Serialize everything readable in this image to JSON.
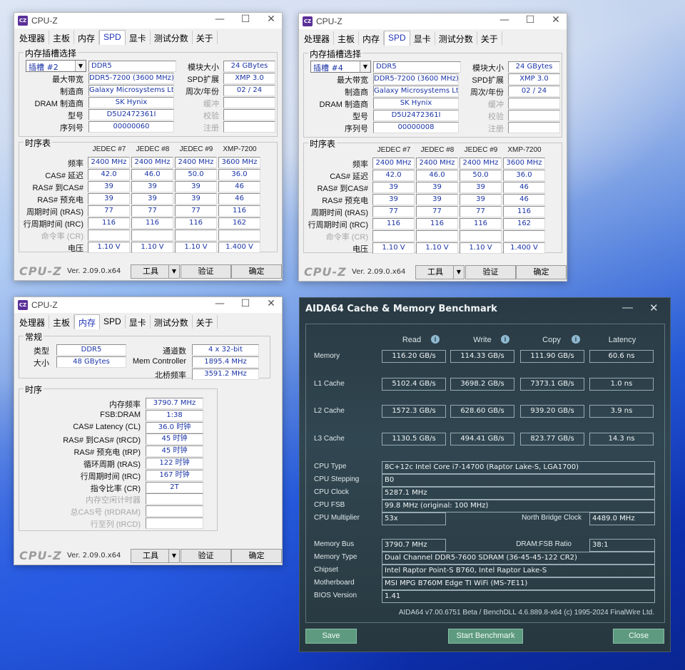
{
  "cpuz_common": {
    "title": "CPU-Z",
    "tabs": [
      "处理器",
      "主板",
      "内存",
      "SPD",
      "显卡",
      "测试分数",
      "关于"
    ],
    "logo": "CPU-Z",
    "version": "Ver. 2.09.0.x64",
    "tools_button": "工具",
    "validate_button": "验证",
    "ok_button": "确定",
    "dropdown_arrow": "▼"
  },
  "spd_labels": {
    "group_slot": "内存插槽选择",
    "module_size": "模块大小",
    "max_bandwidth": "最大带宽",
    "spd_ext": "SPD扩展",
    "manufacturer": "制造商",
    "week_year": "周次/年份",
    "dram_mfr": "DRAM 制造商",
    "buffered": "缓冲",
    "part_number": "型号",
    "correction": "校验",
    "serial": "序列号",
    "registered": "注册",
    "group_timings": "时序表",
    "columns": [
      "JEDEC #7",
      "JEDEC #8",
      "JEDEC #9",
      "XMP-7200"
    ],
    "rows": [
      "频率",
      "CAS# 延迟",
      "RAS# 到CAS#",
      "RAS# 预充电",
      "周期时间 (tRAS)",
      "行周期时间 (tRC)",
      "命令率 (CR)",
      "电压"
    ]
  },
  "spd_slot2": {
    "slot": "插槽 #2",
    "type": "DDR5",
    "module_size": "24 GBytes",
    "max_bandwidth": "DDR5-7200 (3600 MHz)",
    "spd_ext": "XMP 3.0",
    "manufacturer": "Galaxy Microsystems Ltd.",
    "week_year": "02 / 24",
    "dram_mfr": "SK Hynix",
    "part_number": "D5U2472361I",
    "serial": "00000060",
    "timings": [
      [
        "2400 MHz",
        "2400 MHz",
        "2400 MHz",
        "3600 MHz"
      ],
      [
        "42.0",
        "46.0",
        "50.0",
        "36.0"
      ],
      [
        "39",
        "39",
        "39",
        "46"
      ],
      [
        "39",
        "39",
        "39",
        "46"
      ],
      [
        "77",
        "77",
        "77",
        "116"
      ],
      [
        "116",
        "116",
        "116",
        "162"
      ],
      [
        "",
        "",
        "",
        ""
      ],
      [
        "1.10 V",
        "1.10 V",
        "1.10 V",
        "1.400 V"
      ]
    ]
  },
  "spd_slot4": {
    "slot": "插槽 #4",
    "type": "DDR5",
    "module_size": "24 GBytes",
    "max_bandwidth": "DDR5-7200 (3600 MHz)",
    "spd_ext": "XMP 3.0",
    "manufacturer": "Galaxy Microsystems Ltd.",
    "week_year": "02 / 24",
    "dram_mfr": "SK Hynix",
    "part_number": "D5U2472361I",
    "serial": "00000008",
    "timings": [
      [
        "2400 MHz",
        "2400 MHz",
        "2400 MHz",
        "3600 MHz"
      ],
      [
        "42.0",
        "46.0",
        "50.0",
        "36.0"
      ],
      [
        "39",
        "39",
        "39",
        "46"
      ],
      [
        "39",
        "39",
        "39",
        "46"
      ],
      [
        "77",
        "77",
        "77",
        "116"
      ],
      [
        "116",
        "116",
        "116",
        "162"
      ],
      [
        "",
        "",
        "",
        ""
      ],
      [
        "1.10 V",
        "1.10 V",
        "1.10 V",
        "1.400 V"
      ]
    ]
  },
  "memory_tab": {
    "group_general": "常规",
    "type_label": "类型",
    "type": "DDR5",
    "size_label": "大小",
    "size": "48 GBytes",
    "channels_label": "通道数",
    "channels": "4 x 32-bit",
    "mem_controller_label": "Mem Controller",
    "mem_controller": "1895.4 MHz",
    "nb_freq_label": "北桥频率",
    "nb_freq": "3591.2 MHz",
    "group_timings": "时序",
    "rows": [
      {
        "label": "内存频率",
        "value": "3790.7 MHz",
        "disabled": false
      },
      {
        "label": "FSB:DRAM",
        "value": "1:38",
        "disabled": false
      },
      {
        "label": "CAS# Latency (CL)",
        "value": "36.0 时钟",
        "disabled": false
      },
      {
        "label": "RAS# 到CAS# (tRCD)",
        "value": "45 时钟",
        "disabled": false
      },
      {
        "label": "RAS# 预充电 (tRP)",
        "value": "45 时钟",
        "disabled": false
      },
      {
        "label": "循环周期 (tRAS)",
        "value": "122 时钟",
        "disabled": false
      },
      {
        "label": "行周期时间 (tRC)",
        "value": "167 时钟",
        "disabled": false
      },
      {
        "label": "指令比率 (CR)",
        "value": "2T",
        "disabled": false
      },
      {
        "label": "内存空闲计时器",
        "value": "",
        "disabled": true
      },
      {
        "label": "总CAS号 (tRDRAM)",
        "value": "",
        "disabled": true
      },
      {
        "label": "行至列 (tRCD)",
        "value": "",
        "disabled": true
      }
    ]
  },
  "aida": {
    "title": "AIDA64 Cache & Memory Benchmark",
    "minimize": "—",
    "close": "✕",
    "info_glyph": "i",
    "headers": [
      "Read",
      "Write",
      "Copy",
      "Latency"
    ],
    "bench_rows": [
      {
        "label": "Memory",
        "values": [
          "116.20 GB/s",
          "114.33 GB/s",
          "111.90 GB/s",
          "60.6 ns"
        ]
      },
      {
        "label": "L1 Cache",
        "values": [
          "5102.4 GB/s",
          "3698.2 GB/s",
          "7373.1 GB/s",
          "1.0 ns"
        ]
      },
      {
        "label": "L2 Cache",
        "values": [
          "1572.3 GB/s",
          "628.60 GB/s",
          "939.20 GB/s",
          "3.9 ns"
        ]
      },
      {
        "label": "L3 Cache",
        "values": [
          "1130.5 GB/s",
          "494.41 GB/s",
          "823.77 GB/s",
          "14.3 ns"
        ]
      }
    ],
    "cpu_type_label": "CPU Type",
    "cpu_type": "8C+12c Intel Core i7-14700  (Raptor Lake-S, LGA1700)",
    "cpu_stepping_label": "CPU Stepping",
    "cpu_stepping": "B0",
    "cpu_clock_label": "CPU Clock",
    "cpu_clock": "5287.1 MHz",
    "cpu_fsb_label": "CPU FSB",
    "cpu_fsb": "99.8 MHz  (original: 100 MHz)",
    "cpu_multiplier_label": "CPU Multiplier",
    "cpu_multiplier": "53x",
    "nb_clock_label": "North Bridge Clock",
    "nb_clock": "4489.0 MHz",
    "memory_bus_label": "Memory Bus",
    "memory_bus": "3790.7 MHz",
    "dram_fsb_label": "DRAM:FSB Ratio",
    "dram_fsb": "38:1",
    "memory_type_label": "Memory Type",
    "memory_type": "Dual Channel DDR5-7600 SDRAM  (36-45-45-122 CR2)",
    "chipset_label": "Chipset",
    "chipset": "Intel Raptor Point-S B760, Intel Raptor Lake-S",
    "motherboard_label": "Motherboard",
    "motherboard": "MSI MPG B760M Edge TI WiFi (MS-7E11)",
    "bios_label": "BIOS Version",
    "bios": "1.41",
    "footer": "AIDA64 v7.00.6751 Beta / BenchDLL 4.6.889.8-x64  (c) 1995-2024 FinalWire Ltd.",
    "save_button": "Save",
    "start_button": "Start Benchmark",
    "close_button": "Close"
  }
}
